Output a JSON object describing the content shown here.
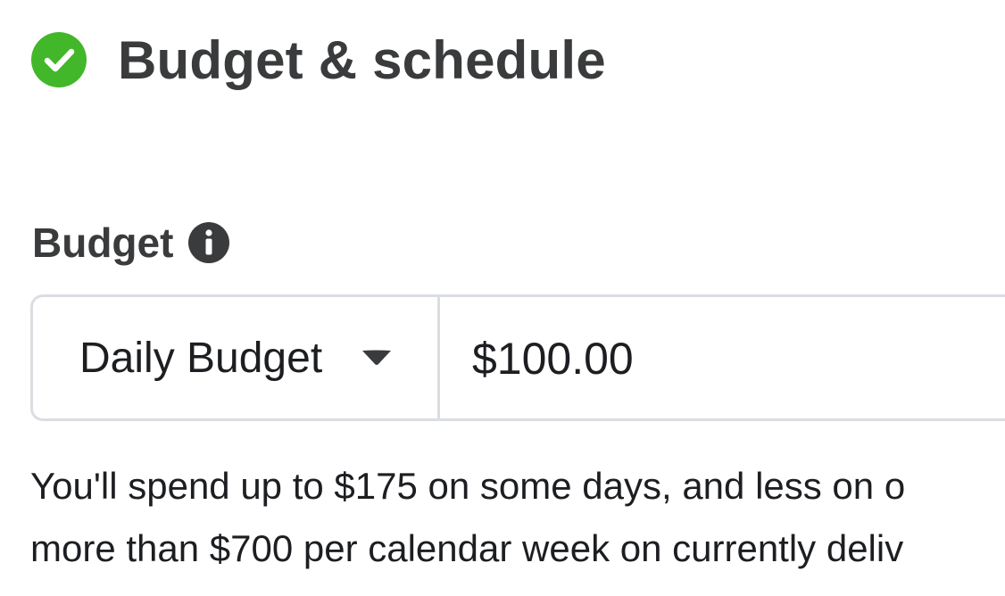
{
  "section": {
    "title": "Budget & schedule",
    "status_icon": "check-circle-icon",
    "status_color": "#42b72a"
  },
  "budget": {
    "label": "Budget",
    "info_icon": "info-icon",
    "type_selected": "Daily Budget",
    "amount_value": "$100.00",
    "help_lines": [
      "You'll spend up to $175 on some days, and less on o",
      "more than $700 per calendar week on currently deliv"
    ]
  },
  "colors": {
    "text_primary": "#1c1e21",
    "text_heading": "#3a3b3c",
    "border": "#dadde1",
    "icon_dark": "#3a3b3c"
  }
}
